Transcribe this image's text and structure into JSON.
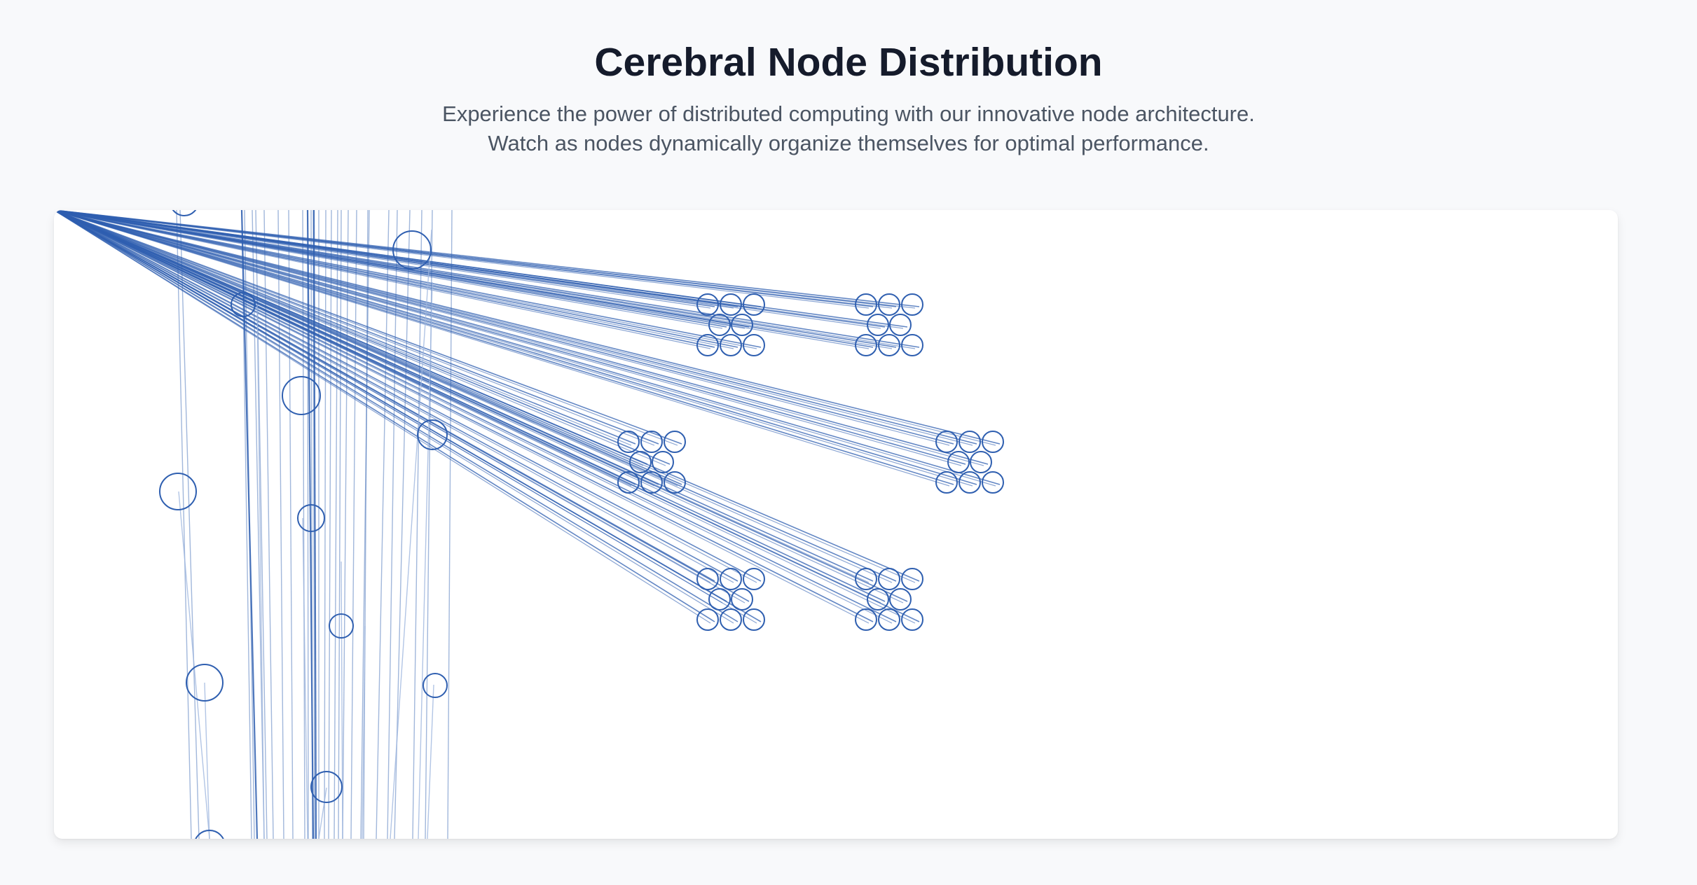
{
  "header": {
    "title": "Cerebral Node Distribution",
    "subtitle_line1": "Experience the power of distributed computing with our innovative node architecture.",
    "subtitle_line2": "Watch as nodes dynamically organize themselves for optimal performance."
  },
  "colors": {
    "node_stroke": "#2f5fb0",
    "link_strong": "#2f5fb0",
    "link_faint": "#9fb6de",
    "card_background": "#ffffff",
    "page_background": "#f8f9fb",
    "title": "#151b2b",
    "subtitle": "#4b5563"
  },
  "diagram": {
    "clusters": 6,
    "nodes_per_cluster": 8,
    "free_nodes": 12
  }
}
